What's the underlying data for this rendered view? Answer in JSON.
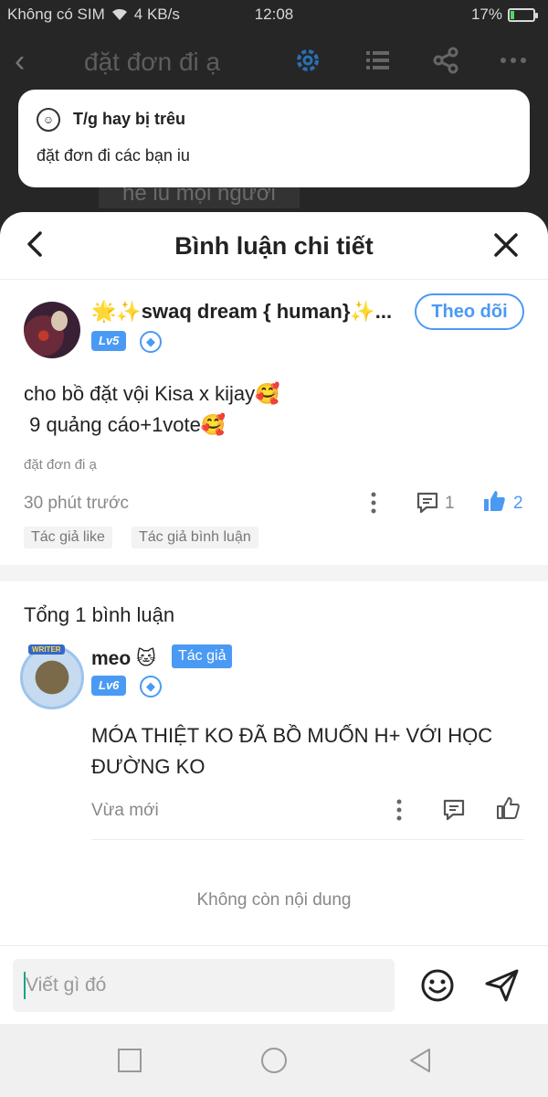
{
  "status_bar": {
    "carrier": "Không có SIM",
    "speed": "4 KB/s",
    "time": "12:08",
    "battery": "17%",
    "battery_level": 0.17
  },
  "app_header": {
    "title": "đặt đơn đi ạ",
    "background_text": "hê iu mọi người"
  },
  "toast": {
    "name": "T/g hay bị trêu",
    "message": "đặt đơn đi các bạn iu"
  },
  "sheet": {
    "title": "Bình luận chi tiết"
  },
  "post": {
    "author": "🌟✨swaq dream { human}✨...",
    "level": "Lv5",
    "follow_label": "Theo dõi",
    "text": "cho bồ đặt vội Kisa x kijay🥰\n 9 quảng cáo+1vote🥰",
    "source": "đặt đơn đi ạ",
    "time": "30 phút trước",
    "comment_count": "1",
    "like_count": "2",
    "tags": [
      "Tác giả like",
      "Tác giả bình luận"
    ]
  },
  "comments_section": {
    "total_label": "Tổng 1 bình luận",
    "items": [
      {
        "author": "meo 🐱",
        "avatar_badge": "WRITER",
        "badge": "Tác giả",
        "level": "Lv6",
        "text": "MÓA THIỆT KO ĐÃ BỒ MUỐN H+ VỚI HỌC ĐƯỜNG KO",
        "time": "Vừa mới"
      }
    ],
    "end_label": "Không còn nội dung"
  },
  "composer": {
    "placeholder": "Viết gì đó"
  },
  "colors": {
    "accent": "#4a9af4",
    "overlay": "#262626"
  }
}
